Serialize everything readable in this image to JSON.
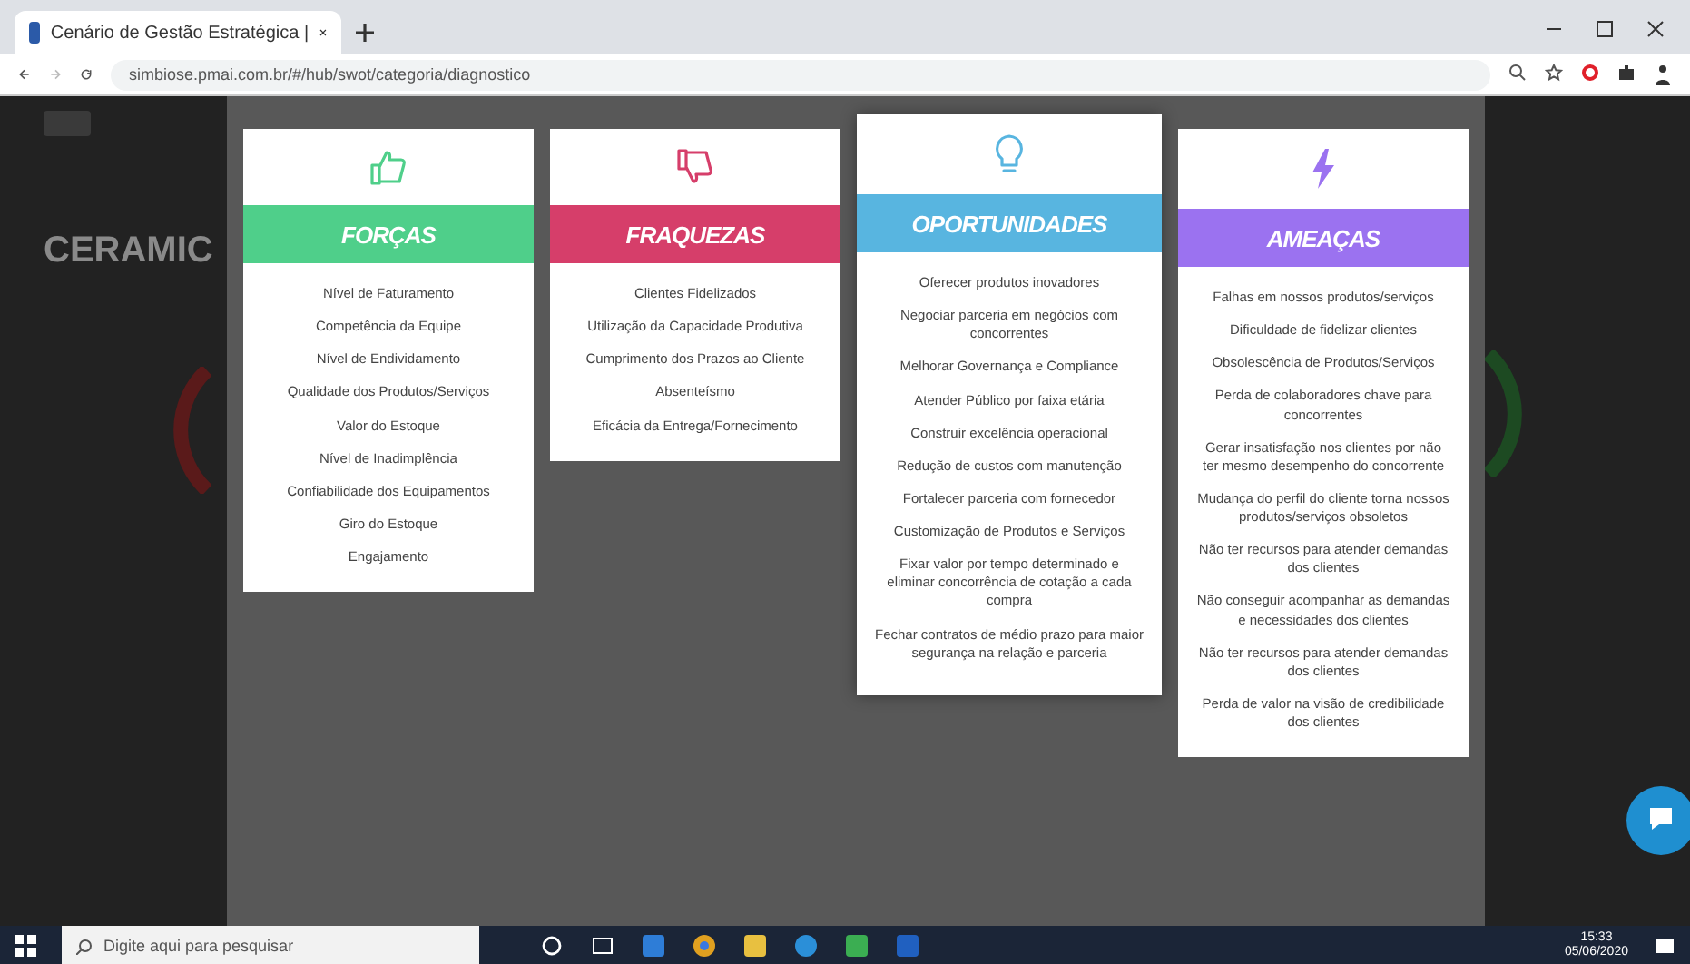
{
  "browser": {
    "tab_title": "Cenário de Gestão Estratégica |",
    "url": "simbiose.pmai.com.br/#/hub/swot/categoria/diagnostico"
  },
  "page": {
    "title": "CERAMIC"
  },
  "cards": [
    {
      "kind": "up",
      "title": "FORÇAS",
      "color": "#4fcf8a",
      "highlighted": false,
      "items": [
        "Nível de Faturamento",
        "Competência da Equipe",
        "Nível de Endividamento",
        "Qualidade dos Produtos/Serviços",
        "Valor do Estoque",
        "Nível de Inadimplência",
        "Confiabilidade dos Equipamentos",
        "Giro do Estoque",
        "Engajamento"
      ]
    },
    {
      "kind": "down",
      "title": "FRAQUEZAS",
      "color": "#d63e6a",
      "highlighted": false,
      "items": [
        "Clientes Fidelizados",
        "Utilização da Capacidade Produtiva",
        "Cumprimento dos Prazos ao Cliente",
        "Absenteísmo",
        "Eficácia da Entrega/Fornecimento"
      ]
    },
    {
      "kind": "bulb",
      "title": "OPORTUNIDADES",
      "color": "#58b5e0",
      "highlighted": true,
      "items": [
        "Oferecer produtos inovadores",
        "Negociar parceria em negócios com concorrentes",
        "Melhorar Governança e Compliance",
        "Atender Público por faixa etária",
        "Construir excelência operacional",
        "Redução de custos com manutenção",
        "Fortalecer parceria com fornecedor",
        "Customização de Produtos e Serviços",
        "Fixar valor por tempo determinado e eliminar concorrência de cotação a cada compra",
        "Fechar contratos de médio prazo para maior segurança na relação e parceria"
      ]
    },
    {
      "kind": "bolt",
      "title": "AMEAÇAS",
      "color": "#9b72f0",
      "highlighted": false,
      "items": [
        "Falhas em nossos produtos/serviços",
        "Dificuldade de fidelizar clientes",
        "Obsolescência de Produtos/Serviços",
        "Perda de colaboradores chave para concorrentes",
        "Gerar insatisfação nos clientes por não ter mesmo desempenho do concorrente",
        "Mudança do perfil do cliente torna nossos produtos/serviços obsoletos",
        "Não ter recursos para atender demandas dos clientes",
        "Não conseguir acompanhar as demandas e necessidades dos clientes",
        "Não ter recursos para atender demandas dos clientes",
        "Perda de valor na visão de credibilidade dos clientes"
      ]
    }
  ],
  "taskbar": {
    "search_placeholder": "Digite aqui para pesquisar",
    "time": "15:33",
    "date": "05/06/2020"
  }
}
